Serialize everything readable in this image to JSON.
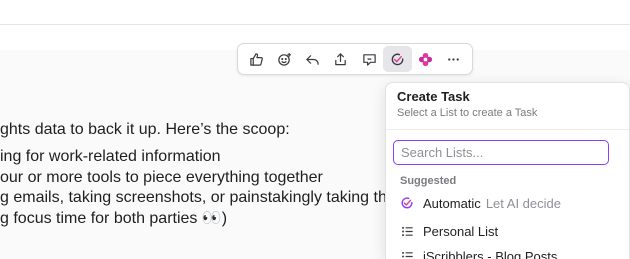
{
  "document": {
    "lines": [
      "ghts data to back it up. Here’s the scoop:",
      "ing for work-related information",
      "our or more tools to piece everything together",
      "g emails, taking screenshots, or painstakingly taking their own notes",
      "g focus time for both parties 👀)"
    ]
  },
  "toolbar": {
    "items": [
      {
        "icon": "thumbs-up-icon"
      },
      {
        "icon": "emoji-add-icon"
      },
      {
        "icon": "reply-icon"
      },
      {
        "icon": "share-icon"
      },
      {
        "icon": "comment-icon"
      },
      {
        "icon": "create-task-icon",
        "active": true
      },
      {
        "icon": "clickup-apps-icon"
      },
      {
        "icon": "more-icon"
      }
    ]
  },
  "create_task": {
    "title": "Create Task",
    "subtitle": "Select a List to create a Task",
    "search_placeholder": "Search Lists...",
    "section_label": "Suggested",
    "items": [
      {
        "label": "Automatic",
        "hint": "Let AI decide",
        "icon": "ai-automatic-icon"
      },
      {
        "label": "Personal List",
        "icon": "list-icon"
      },
      {
        "label": "iScribblers - Blog Posts",
        "icon": "list-icon"
      }
    ]
  },
  "colors": {
    "accent": "#8a3ffc",
    "pink": "#e3379e"
  }
}
